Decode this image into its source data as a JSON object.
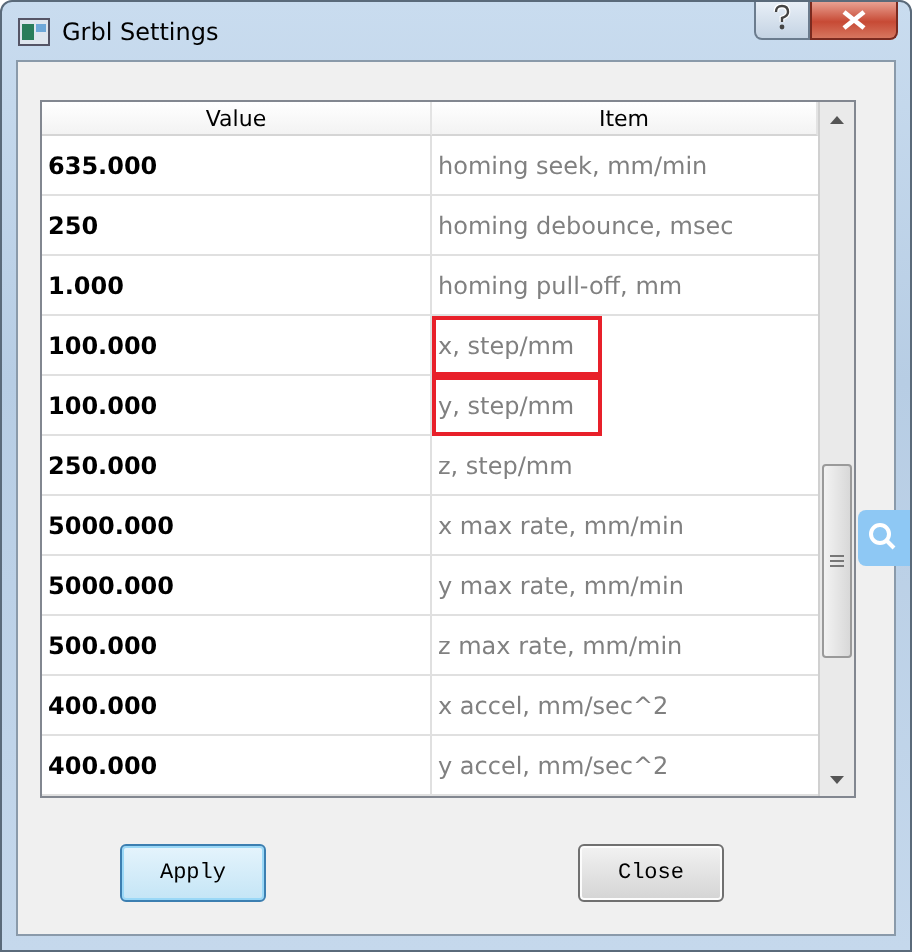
{
  "window": {
    "title": "Grbl Settings"
  },
  "table": {
    "columns": [
      "Value",
      "Item"
    ],
    "rows": [
      {
        "value": "635.000",
        "item": "homing seek, mm/min",
        "highlighted": false
      },
      {
        "value": "250",
        "item": "homing debounce, msec",
        "highlighted": false
      },
      {
        "value": "1.000",
        "item": "homing pull-off, mm",
        "highlighted": false
      },
      {
        "value": "100.000",
        "item": "x, step/mm",
        "highlighted": true
      },
      {
        "value": "100.000",
        "item": "y, step/mm",
        "highlighted": true
      },
      {
        "value": "250.000",
        "item": "z, step/mm",
        "highlighted": false
      },
      {
        "value": "5000.000",
        "item": "x max rate, mm/min",
        "highlighted": false
      },
      {
        "value": "5000.000",
        "item": "y max rate, mm/min",
        "highlighted": false
      },
      {
        "value": "500.000",
        "item": "z max rate, mm/min",
        "highlighted": false
      },
      {
        "value": "400.000",
        "item": "x accel, mm/sec^2",
        "highlighted": false
      },
      {
        "value": "400.000",
        "item": "y accel, mm/sec^2",
        "highlighted": false
      }
    ]
  },
  "buttons": [
    {
      "label": "Apply",
      "focused": true
    },
    {
      "label": "Close",
      "focused": false
    }
  ]
}
